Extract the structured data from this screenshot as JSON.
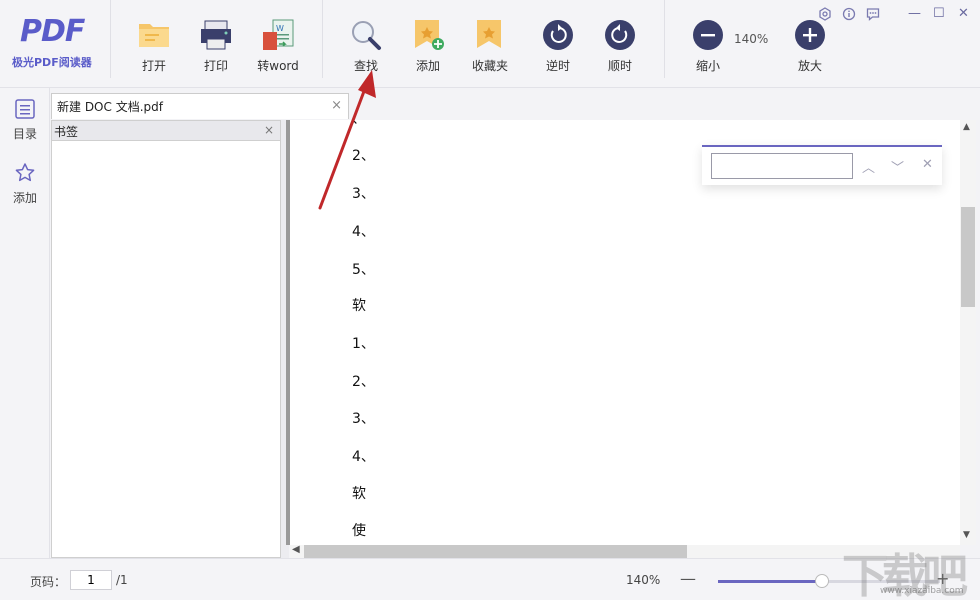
{
  "app": {
    "logo_mark": "PDF",
    "logo_text": "极光PDF阅读器"
  },
  "toolbar": {
    "open": "打开",
    "print": "打印",
    "to_word": "转word",
    "find": "查找",
    "add": "添加",
    "favorites": "收藏夹",
    "rotate_ccw": "逆时",
    "rotate_cw": "顺时",
    "zoom_out": "缩小",
    "zoom_level": "140%",
    "zoom_in": "放大"
  },
  "window": {
    "minimize": "—",
    "maximize": "☐",
    "close": "✕"
  },
  "rail": {
    "toc": "目录",
    "add": "添加"
  },
  "tab": {
    "title": "新建 DOC 文档.pdf",
    "close": "×"
  },
  "bookmark_panel": {
    "title": "书签",
    "close": "×"
  },
  "document": {
    "lines": [
      "2、",
      "3、",
      "4、",
      "5、",
      "软",
      "1、",
      "2、",
      "3、",
      "4、",
      "软",
      "使"
    ]
  },
  "find_box": {
    "value": "",
    "prev": "︿",
    "next": "﹀",
    "close": "✕"
  },
  "status": {
    "page_label": "页码：",
    "page_value": "1",
    "page_total": "/1",
    "zoom": "140%",
    "minus": "—",
    "plus": "+",
    "zoom_slider_fraction": 0.47
  },
  "watermark": {
    "big": "下载吧",
    "small": "www.xiazaiba.com"
  },
  "colors": {
    "accent": "#6a66c0",
    "logo": "#5a5cc9",
    "circle_icon": "#3a3f6b"
  }
}
